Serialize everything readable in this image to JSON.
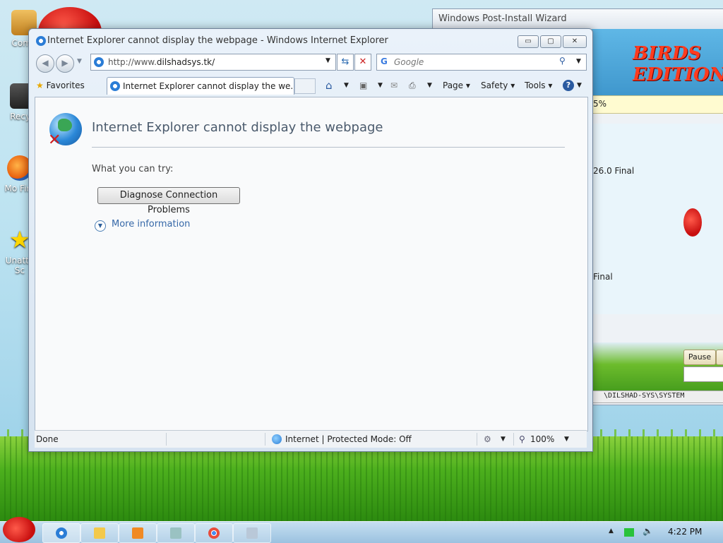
{
  "window": {
    "title": "Internet Explorer cannot display the webpage - Windows Internet Explorer",
    "minimize_label": "▭",
    "maximize_label": "▢",
    "close_label": "✕"
  },
  "navigation": {
    "url_prefix": "http://www.",
    "url_domain": "dilshadsys.tk/",
    "search_placeholder": "Google"
  },
  "toolbar": {
    "favorites_label": "Favorites",
    "tab_label": "Internet Explorer cannot display the we...",
    "page_label": "Page ▾",
    "safety_label": "Safety ▾",
    "tools_label": "Tools ▾"
  },
  "content": {
    "heading": "Internet Explorer cannot display the webpage",
    "what_you_can_try": "What you can try:",
    "diagnose_button": "Diagnose Connection Problems",
    "more_information": "More information"
  },
  "status": {
    "left": "Done",
    "zone": "Internet | Protected Mode: Off",
    "zoom": "100%"
  },
  "wizard": {
    "title": "Windows Post-Install Wizard",
    "banner_text": "BIRDS EDITION",
    "progress_text": "5%",
    "item1": "26.0 Final",
    "item2": "Final",
    "pause_button": "Pause",
    "path_text": "\\DILSHAD-SYS\\SYSTEM"
  },
  "desktop": {
    "icon1_label": "Comp",
    "icon2_label": "Recyc",
    "icon3_label": "Mo Fire",
    "icon4_label": "Unatte Sc"
  },
  "taskbar": {
    "clock": "4:22 PM"
  }
}
